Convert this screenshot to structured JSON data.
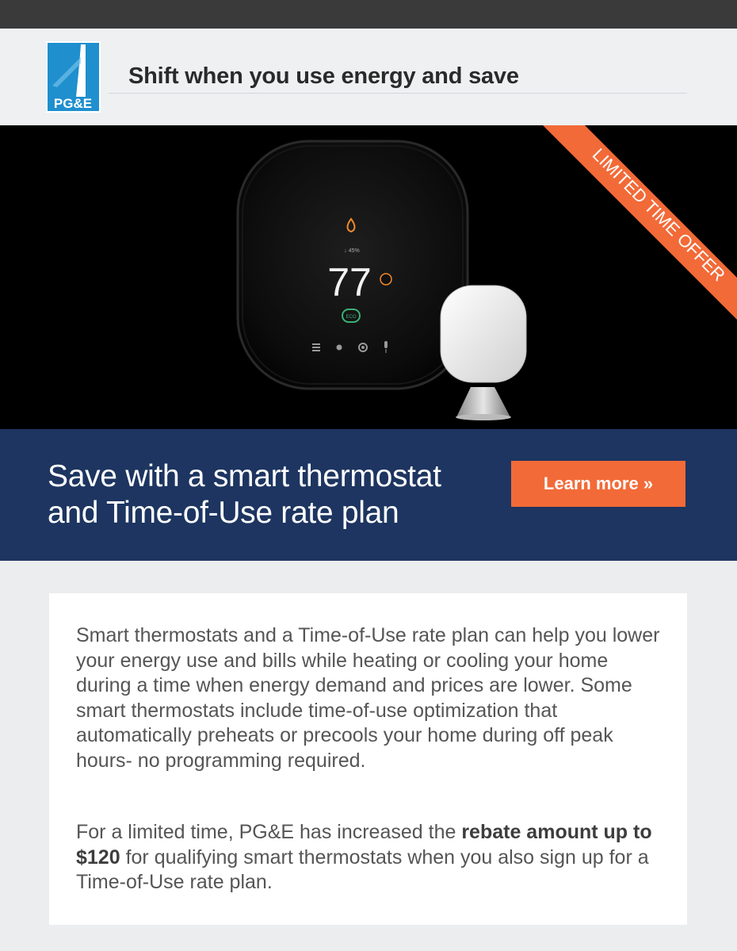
{
  "header": {
    "logo_text": "PG&E",
    "headline": "Shift when you use energy and save"
  },
  "hero": {
    "ribbon": "LIMITED TIME OFFER",
    "thermostat_temperature": "77",
    "thermostat_humidity": "↓ 45%",
    "thermostat_mode": "ECO"
  },
  "promo": {
    "title_line1": "Save with a smart thermostat",
    "title_line2": "and Time-of-Use rate plan",
    "cta_label": "Learn more »"
  },
  "body": {
    "paragraph1": "Smart thermostats and a Time-of-Use rate plan can help you lower your energy use and bills while heating or cooling your home during a time when energy demand and prices are lower. Some smart thermostats include time-of-use optimization that automatically preheats or precools your home during off peak hours- no programming required.",
    "paragraph2_prefix": "For a limited time, PG&E has increased the ",
    "paragraph2_bold": "rebate amount up to $120",
    "paragraph2_suffix": " for qualifying smart thermostats when you also sign up for a Time-of-Use rate plan."
  },
  "colors": {
    "topbar": "#3a3a3b",
    "promo_band": "#1d3560",
    "cta": "#f26a38",
    "ribbon": "#f26a38",
    "logo_blue": "#1f8fce"
  }
}
